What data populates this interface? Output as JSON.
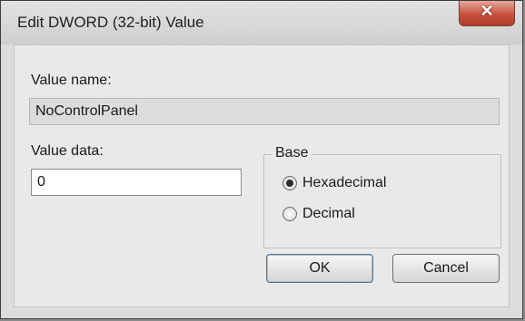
{
  "window": {
    "title": "Edit DWORD (32-bit) Value",
    "close_glyph": "✕"
  },
  "value_name": {
    "label": "Value name:",
    "value": "NoControlPanel"
  },
  "value_data": {
    "label": "Value data:",
    "value": "0"
  },
  "base": {
    "label": "Base",
    "options": [
      {
        "label": "Hexadecimal",
        "selected": true
      },
      {
        "label": "Decimal",
        "selected": false
      }
    ]
  },
  "buttons": {
    "ok": "OK",
    "cancel": "Cancel"
  },
  "icons": {
    "close": "close-icon"
  }
}
